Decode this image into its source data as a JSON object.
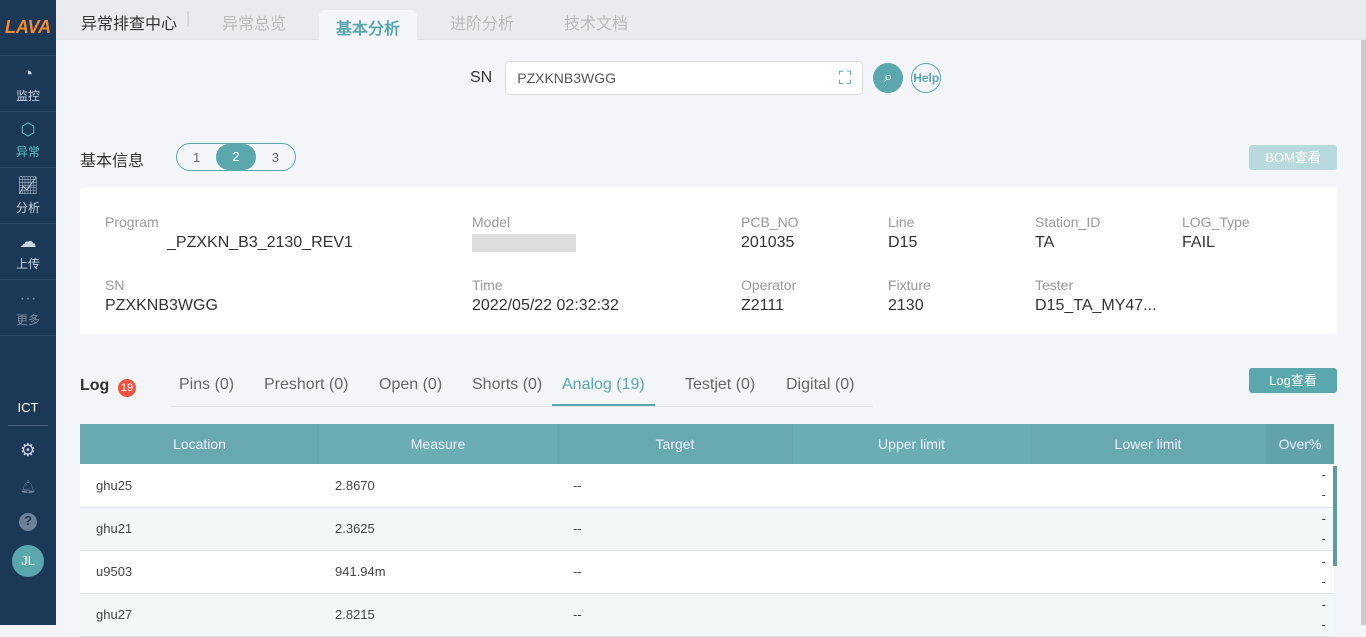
{
  "sidebar": {
    "logo": "LAVA",
    "items": [
      {
        "label": "监控"
      },
      {
        "label": "异常"
      },
      {
        "label": "分析"
      },
      {
        "label": "上传"
      },
      {
        "label": "更多"
      }
    ],
    "ict": "ICT",
    "avatar": "JL"
  },
  "topbar": {
    "title": "异常排查中心",
    "tabs": [
      "异常总览",
      "基本分析",
      "进阶分析",
      "技术文档"
    ]
  },
  "search": {
    "label": "SN",
    "value": "PZXKNB3WGG",
    "help": "Help"
  },
  "info": {
    "title": "基本信息",
    "steps": [
      "1",
      "2",
      "3"
    ],
    "bom": "BOM查看",
    "fields": [
      {
        "label": "Program",
        "value": "_PZXKN_B3_2130_REV1"
      },
      {
        "label": "Model",
        "value": ""
      },
      {
        "label": "PCB_NO",
        "value": "201035"
      },
      {
        "label": "Line",
        "value": "D15"
      },
      {
        "label": "Station_ID",
        "value": "TA"
      },
      {
        "label": "LOG_Type",
        "value": "FAIL"
      },
      {
        "label": "SN",
        "value": "PZXKNB3WGG"
      },
      {
        "label": "Time",
        "value": "2022/05/22 02:32:32"
      },
      {
        "label": "Operator",
        "value": "Z2111"
      },
      {
        "label": "Fixture",
        "value": "2130"
      },
      {
        "label": "Tester",
        "value": "D15_TA_MY47..."
      }
    ]
  },
  "log": {
    "title": "Log",
    "badge": "19",
    "view": "Log查看",
    "tabs": [
      "Pins (0)",
      "Preshort (0)",
      "Open (0)",
      "Shorts (0)",
      "Analog (19)",
      "Testjet (0)",
      "Digital (0)"
    ]
  },
  "table": {
    "headers": [
      "Location",
      "Measure",
      "Target",
      "Upper limit",
      "Lower limit",
      "Over%"
    ],
    "rows": [
      [
        "ghu25",
        "2.8670",
        "--",
        "",
        "",
        "--"
      ],
      [
        "ghu21",
        "2.3625",
        "--",
        "",
        "",
        "--"
      ],
      [
        "u9503",
        "941.94m",
        "--",
        "",
        "",
        "--"
      ],
      [
        "ghu27",
        "2.8215",
        "--",
        "",
        "",
        "--"
      ]
    ]
  }
}
